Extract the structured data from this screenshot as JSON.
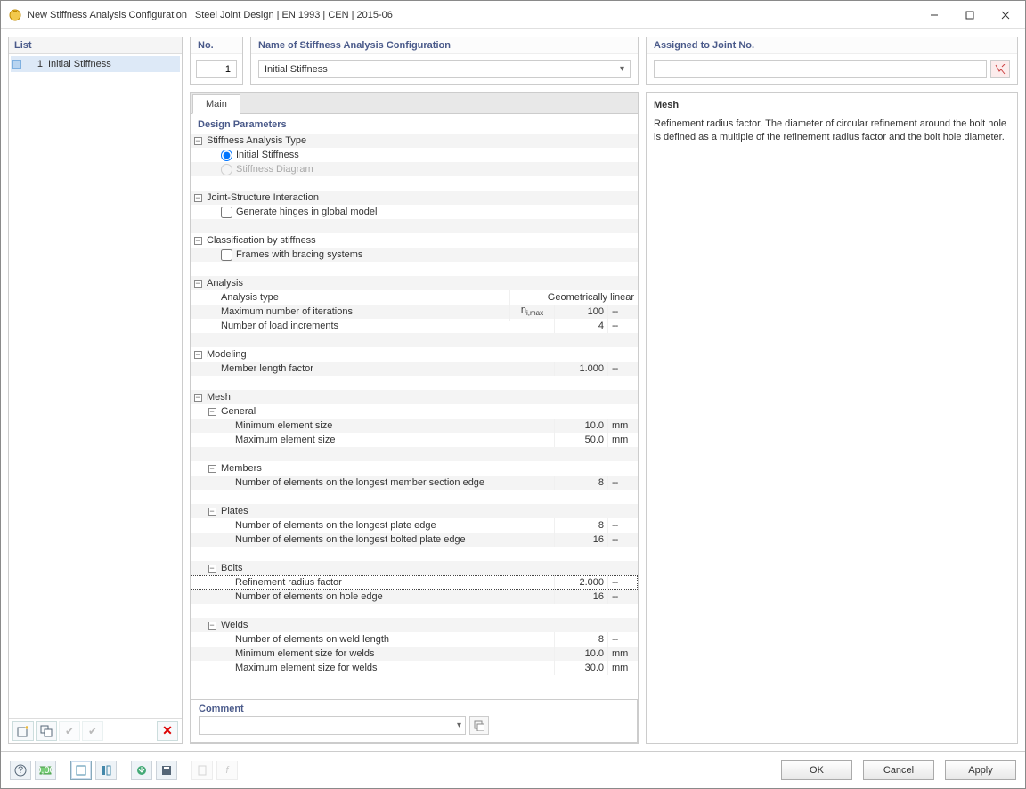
{
  "window": {
    "title": "New Stiffness Analysis Configuration | Steel Joint Design | EN 1993 | CEN | 2015-06"
  },
  "left": {
    "header": "List",
    "item": {
      "num": "1",
      "label": "Initial Stiffness"
    }
  },
  "top": {
    "no_label": "No.",
    "no_value": "1",
    "name_label": "Name of Stiffness Analysis Configuration",
    "name_value": "Initial Stiffness",
    "assigned_label": "Assigned to Joint No."
  },
  "tabs": {
    "main": "Main"
  },
  "params": {
    "header": "Design Parameters",
    "stiffness_type": {
      "label": "Stiffness Analysis Type",
      "initial": "Initial Stiffness",
      "diagram": "Stiffness Diagram"
    },
    "joint_struct": {
      "label": "Joint-Structure Interaction",
      "generate": "Generate hinges in global model"
    },
    "class": {
      "label": "Classification by stiffness",
      "frames": "Frames with bracing systems"
    },
    "analysis": {
      "label": "Analysis",
      "type": "Analysis type",
      "type_val": "Geometrically linear",
      "iter": "Maximum number of iterations",
      "iter_sym_a": "n",
      "iter_sym_b": "i,max",
      "iter_val": "100",
      "load": "Number of load increments",
      "load_val": "4"
    },
    "modeling": {
      "label": "Modeling",
      "member": "Member length factor",
      "member_val": "1.000"
    },
    "mesh": {
      "label": "Mesh",
      "general": {
        "label": "General",
        "min": "Minimum element size",
        "min_val": "10.0",
        "min_u": "mm",
        "max": "Maximum element size",
        "max_val": "50.0",
        "max_u": "mm"
      },
      "members": {
        "label": "Members",
        "n1": "Number of elements on the longest member section edge",
        "n1_val": "8"
      },
      "plates": {
        "label": "Plates",
        "n1": "Number of elements on the longest plate edge",
        "n1_val": "8",
        "n2": "Number of elements on the longest bolted plate edge",
        "n2_val": "16"
      },
      "bolts": {
        "label": "Bolts",
        "refine": "Refinement radius factor",
        "refine_val": "2.000",
        "hole": "Number of elements on hole edge",
        "hole_val": "16"
      },
      "welds": {
        "label": "Welds",
        "n1": "Number of elements on weld length",
        "n1_val": "8",
        "min": "Minimum element size for welds",
        "min_val": "10.0",
        "min_u": "mm",
        "max": "Maximum element size for welds",
        "max_val": "30.0",
        "max_u": "mm"
      }
    }
  },
  "dash": "--",
  "comment": {
    "label": "Comment"
  },
  "info": {
    "title": "Mesh",
    "text": "Refinement radius factor. The diameter of circular refinement around the bolt hole is defined as a multiple of the refinement radius factor and the bolt hole diameter."
  },
  "footer": {
    "ok": "OK",
    "cancel": "Cancel",
    "apply": "Apply"
  }
}
